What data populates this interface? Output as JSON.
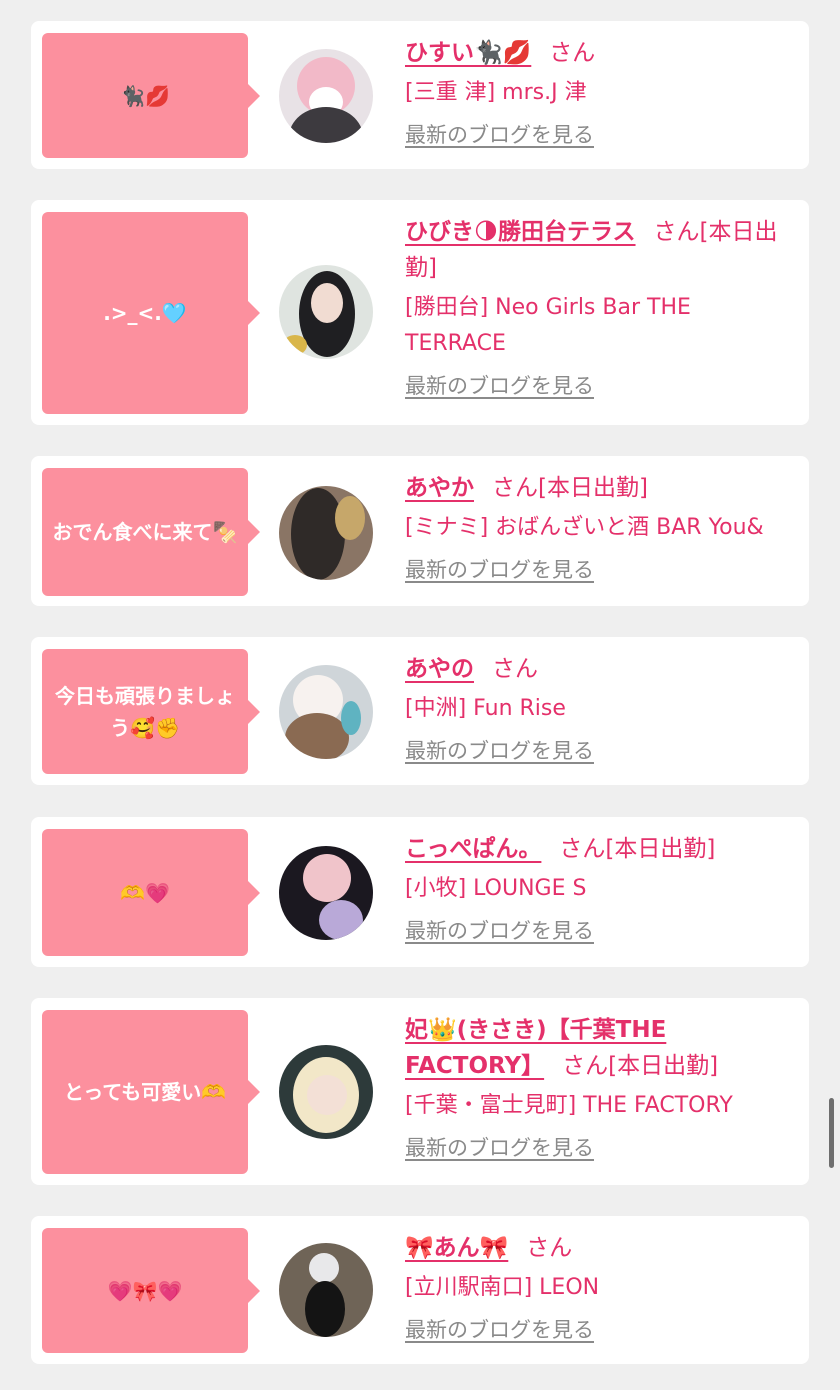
{
  "colors": {
    "accent": "#e4306a",
    "bubble": "#fc909e",
    "link_gray": "#8a8a8a",
    "background": "#efefef"
  },
  "cards": [
    {
      "message": "🐈‍⬛💋",
      "name": "ひすい🐈‍⬛💋",
      "san": "さん",
      "shift": "",
      "area": "[三重 津]",
      "shop": "mrs.J 津",
      "blog_link": "最新のブログを見る"
    },
    {
      "message": ".>_<.🩵",
      "name": "ひびき🌗勝田台テラス",
      "san": "さん",
      "shift": "[本日出勤]",
      "area": "[勝田台]",
      "shop": "Neo Girls Bar THE TERRACE",
      "blog_link": "最新のブログを見る"
    },
    {
      "message": "おでん食べに来て🍢",
      "name": "あやか",
      "san": "さん",
      "shift": "[本日出勤]",
      "area": "[ミナミ]",
      "shop": "おばんざいと酒 BAR You&",
      "blog_link": "最新のブログを見る"
    },
    {
      "message": "今日も頑張りましょう🥰✊",
      "name": "あやの",
      "san": "さん",
      "shift": "",
      "area": "[中洲]",
      "shop": "Fun Rise",
      "blog_link": "最新のブログを見る"
    },
    {
      "message": "🫶💗",
      "name": "こっぺぱん。",
      "san": "さん",
      "shift": "[本日出勤]",
      "area": "[小牧]",
      "shop": "LOUNGE S",
      "blog_link": "最新のブログを見る"
    },
    {
      "message": "とっても可愛い🫶",
      "name": "妃👑(きさき)【千葉THE FACTORY】",
      "san": "さん",
      "shift": "[本日出勤]",
      "area": "[千葉・富士見町]",
      "shop": "THE FACTORY",
      "blog_link": "最新のブログを見る"
    },
    {
      "message": "💗🎀💗",
      "name": "🎀あん🎀",
      "san": "さん",
      "shift": "",
      "area": "[立川駅南口]",
      "shop": "LEON",
      "blog_link": "最新のブログを見る"
    }
  ]
}
